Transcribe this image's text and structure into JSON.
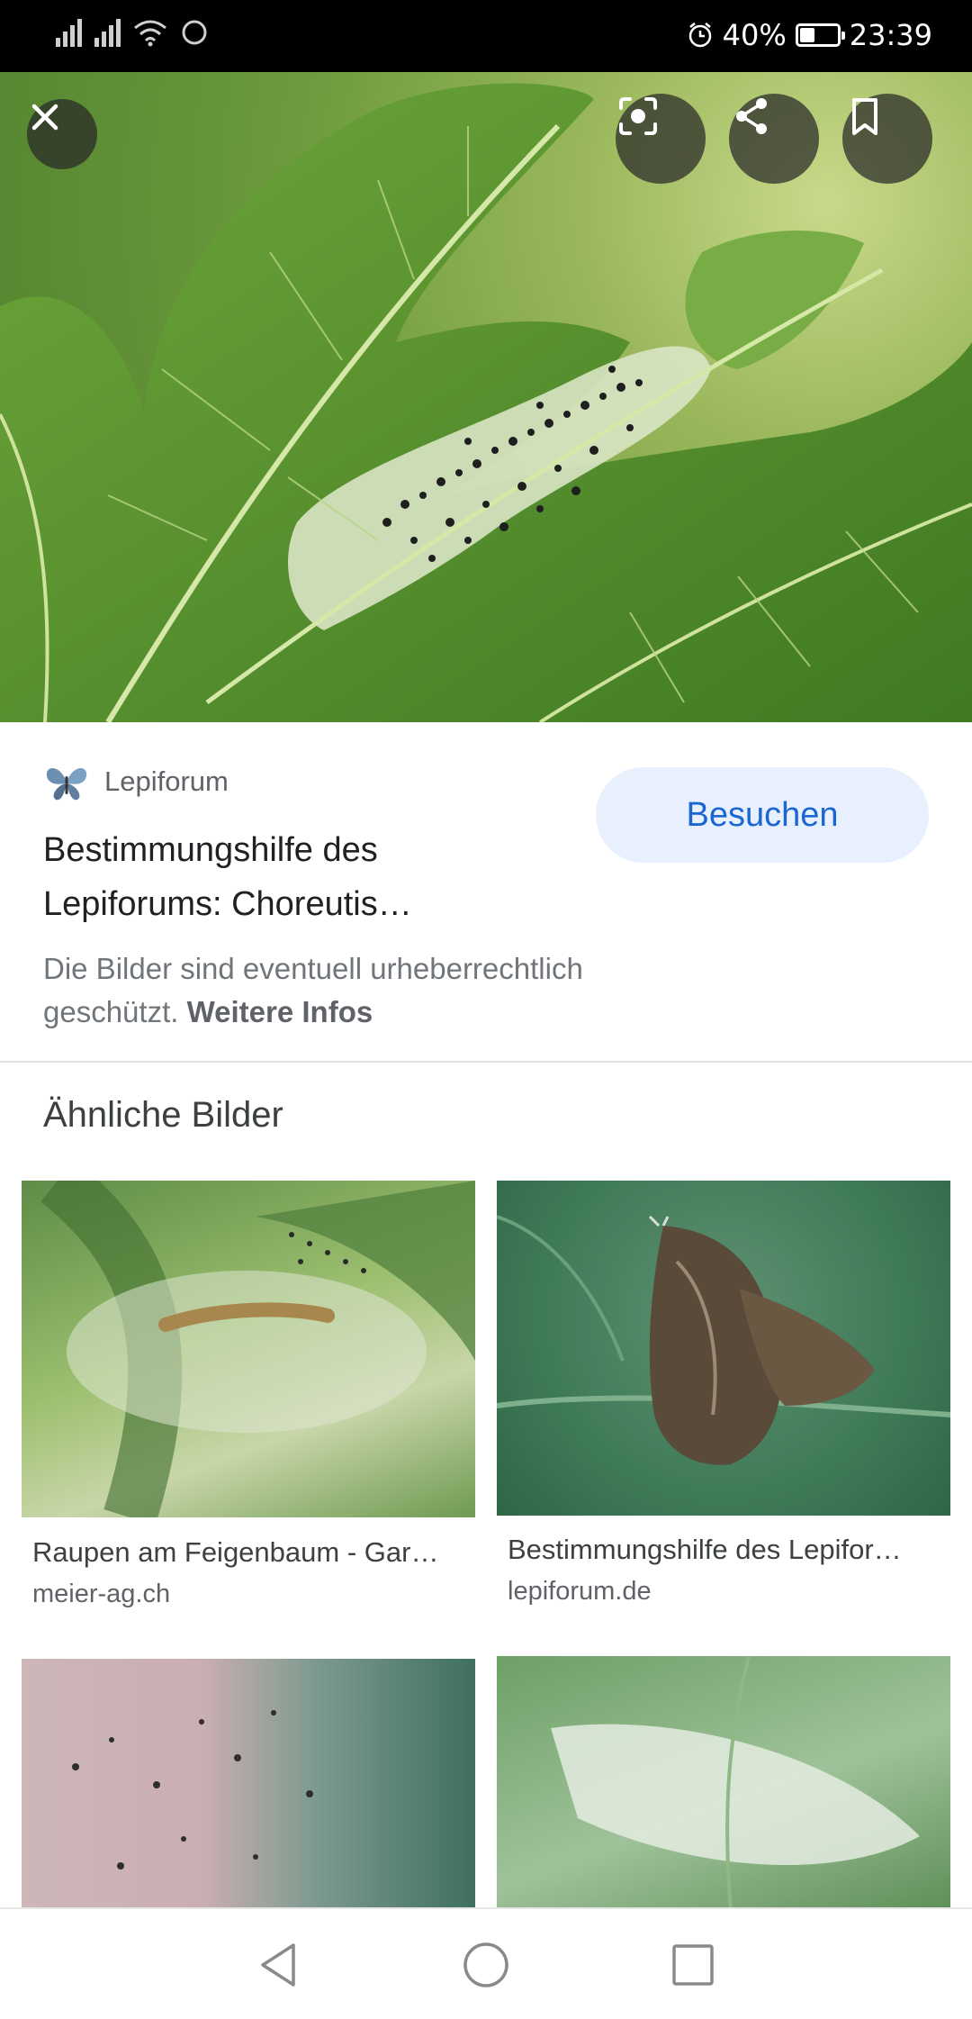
{
  "status_bar": {
    "battery": "40%",
    "time": "23:39",
    "battery_level": 0.4
  },
  "viewer": {
    "icons": [
      "close-icon",
      "lens-icon",
      "share-icon",
      "bookmark-icon"
    ]
  },
  "result": {
    "source": "Lepiforum",
    "title": "Bestimmungshilfe des Lepiforums: Choreutis…",
    "visit_label": "Besuchen",
    "notice": "Die Bilder sind eventuell urheberrechtlich geschützt.",
    "notice_link": "Weitere Infos"
  },
  "similar": {
    "heading": "Ähnliche Bilder",
    "items": [
      {
        "title": "Raupen am Feigenbaum - Gar…",
        "domain": "meier-ag.ch"
      },
      {
        "title": "Bestimmungshilfe des Lepifor…",
        "domain": "lepiforum.de"
      },
      {
        "title": "",
        "domain": ""
      },
      {
        "title": "",
        "domain": ""
      }
    ]
  },
  "colors": {
    "accent": "#1a66d2",
    "button_bg": "#e8f0fe"
  }
}
